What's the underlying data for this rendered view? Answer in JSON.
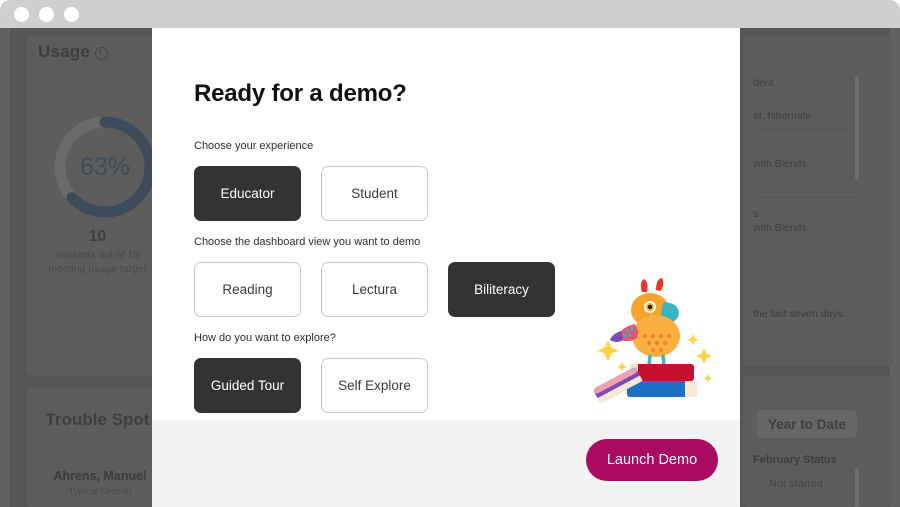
{
  "window": {
    "dots": [
      "close",
      "minimize",
      "maximize"
    ]
  },
  "dashboard": {
    "left": {
      "usage_title": "Usage",
      "usage_info_icon": "info-circle-icon",
      "usage_percent": "63%",
      "usage_count": "10",
      "usage_subtext_line1": "students out of 16",
      "usage_subtext_line2": "meeting usage target",
      "donut_value": 63,
      "donut_arc_color": "#3d4b5b",
      "donut_track_color": "#6a6a6a",
      "trouble_title": "Trouble Spot",
      "trouble_name": "Ahrens, Manuel",
      "trouble_sub": "Typical Growth"
    },
    "right": {
      "rows": [
        "dent",
        "et, hibernate",
        "with Blends",
        "s",
        "with Blends",
        "the last seven days."
      ],
      "ytd_button": "Year to Date",
      "february_status_label": "February Status",
      "february_status_value": "Not started"
    }
  },
  "modal": {
    "title": "Ready for a demo?",
    "sections": [
      {
        "label": "Choose your experience",
        "options": [
          {
            "text": "Educator",
            "selected": true
          },
          {
            "text": "Student",
            "selected": false
          }
        ]
      },
      {
        "label": "Choose the dashboard view you want to demo",
        "options": [
          {
            "text": "Reading",
            "selected": false
          },
          {
            "text": "Lectura",
            "selected": false
          },
          {
            "text": "Biliteracy",
            "selected": true
          }
        ]
      },
      {
        "label": "How do you want to explore?",
        "options": [
          {
            "text": "Guided Tour",
            "selected": true
          },
          {
            "text": "Self Explore",
            "selected": false
          }
        ]
      }
    ],
    "illustration": "parrot-on-books-icon",
    "footer": {
      "launch_label": "Launch Demo",
      "launch_color": "#aa0b60"
    }
  }
}
